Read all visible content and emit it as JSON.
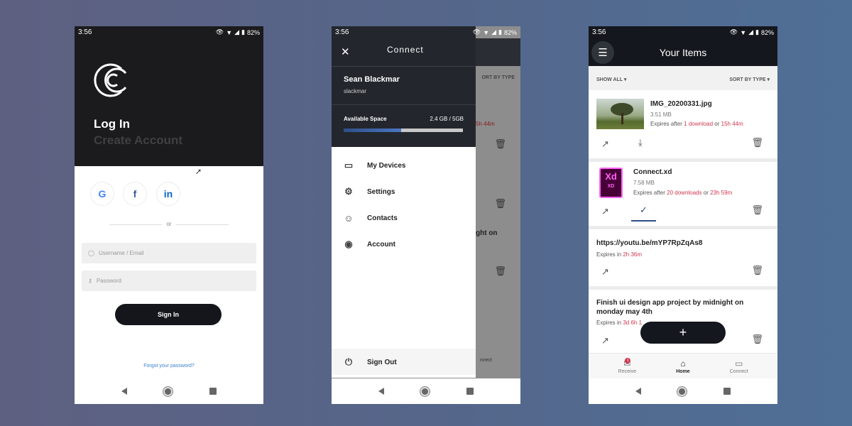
{
  "status": {
    "time": "3:56",
    "battery": "82%"
  },
  "login": {
    "title": "Log In",
    "subtitle": "Create Account",
    "or": "or",
    "username_placeholder": "Username / Email",
    "password_placeholder": "Password",
    "signin_label": "Sign In",
    "forgot_label": "Forgot your password?"
  },
  "drawer": {
    "logo": "Connect",
    "name": "Sean Blackmar",
    "username": "slackmar",
    "space_label": "Available Space",
    "space_value": "2.4 GB / 5GB",
    "space_fraction": 0.48,
    "items": [
      {
        "label": "My Devices",
        "icon": "devices-icon"
      },
      {
        "label": "Settings",
        "icon": "gear-icon"
      },
      {
        "label": "Contacts",
        "icon": "contacts-icon"
      },
      {
        "label": "Account",
        "icon": "account-icon"
      }
    ],
    "signout_label": "Sign Out",
    "bg_sort": "ORT BY TYPE",
    "bg_expiry": "5h 44m",
    "bg_text": "ght on",
    "bg_connect": "nnect"
  },
  "items": {
    "title": "Your Items",
    "show_all": "SHOW ALL",
    "sort": "SORT BY TYPE",
    "list": [
      {
        "name": "IMG_20200331.jpg",
        "size": "3.51 MB",
        "exp_prefix": "Expires after",
        "exp_downloads": "1 download",
        "exp_or": "or",
        "exp_time": "15h 44m"
      },
      {
        "name": "Connect.xd",
        "size": "7.58 MB",
        "exp_prefix": "Expires after",
        "exp_downloads": "20 downloads",
        "exp_or": "or",
        "exp_time": "23h 59m"
      },
      {
        "name": "https://youtu.be/mYP7RpZqAs8",
        "exp_prefix": "Expires in",
        "exp_time": "2h 36m"
      },
      {
        "name": "Finish ui design app project by midnight on monday may 4th",
        "exp_prefix": "Expires in",
        "exp_time": "3d 6h 1"
      }
    ],
    "tabs": [
      {
        "label": "Receive",
        "badge": "1"
      },
      {
        "label": "Home"
      },
      {
        "label": "Connect"
      }
    ],
    "fab": "+"
  }
}
